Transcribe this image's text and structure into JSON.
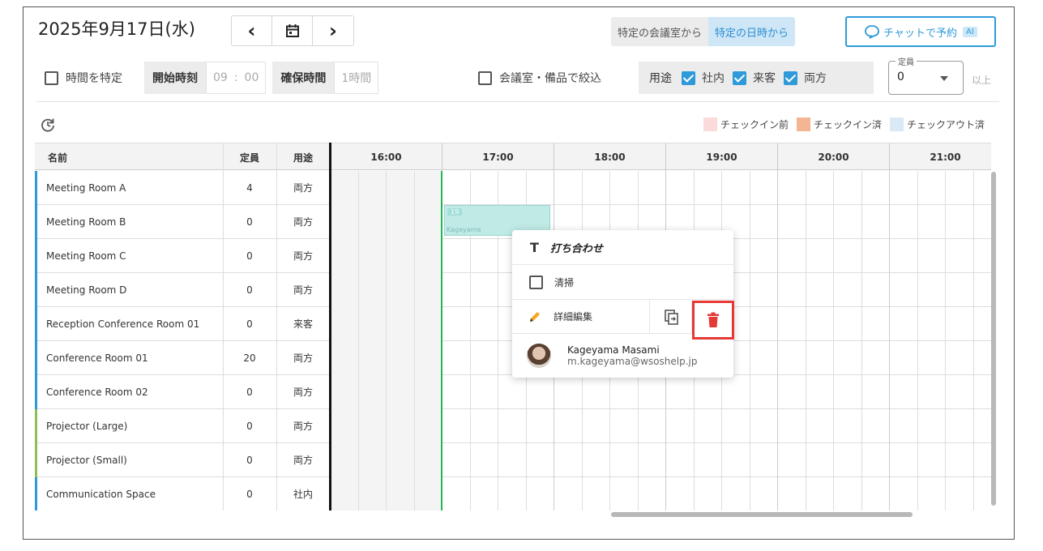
{
  "header": {
    "date_title": "2025年9月17日(水)",
    "prev_icon": "‹",
    "next_icon": "›",
    "mode_room": "特定の会議室から",
    "mode_datetime": "特定の日時から",
    "chat_button": "チャットで予約",
    "ai_badge": "AI"
  },
  "filters": {
    "time_specify_label": "時間を特定",
    "start_time_label": "開始時刻",
    "start_hour": "09",
    "time_colon": ":",
    "start_min": "00",
    "duration_label": "確保時間",
    "duration_value": "1時間",
    "room_filter_label": "会議室・備品で絞込",
    "purpose_label": "用途",
    "purpose_internal": "社内",
    "purpose_visitor": "来客",
    "purpose_both": "両方",
    "capacity_legend": "定員",
    "capacity_value": "0",
    "capacity_suffix": "以上"
  },
  "legend": {
    "before_checkin": "チェックイン前",
    "checked_in": "チェックイン済",
    "checked_out": "チェックアウト済",
    "colors": {
      "before": "#fbdada",
      "checked_in": "#f3b592",
      "checked_out": "#d9e9f6"
    }
  },
  "table": {
    "headers": {
      "name": "名前",
      "capacity": "定員",
      "purpose": "用途"
    },
    "hours": [
      "16:00",
      "17:00",
      "18:00",
      "19:00",
      "20:00",
      "21:00"
    ],
    "rooms": [
      {
        "name": "Meeting Room A",
        "capacity": "4",
        "purpose": "両方",
        "bar": "#2e9ad9"
      },
      {
        "name": "Meeting Room B",
        "capacity": "0",
        "purpose": "両方",
        "bar": "#2e9ad9"
      },
      {
        "name": "Meeting Room C",
        "capacity": "0",
        "purpose": "両方",
        "bar": "#2e9ad9"
      },
      {
        "name": "Meeting Room D",
        "capacity": "0",
        "purpose": "両方",
        "bar": "#2e9ad9"
      },
      {
        "name": "Reception Conference Room 01",
        "capacity": "0",
        "purpose": "来客",
        "bar": "#2e9ad9"
      },
      {
        "name": "Conference Room 01",
        "capacity": "20",
        "purpose": "両方",
        "bar": "#2e9ad9"
      },
      {
        "name": "Conference Room 02",
        "capacity": "0",
        "purpose": "両方",
        "bar": "#2e9ad9"
      },
      {
        "name": "Projector (Large)",
        "capacity": "0",
        "purpose": "両方",
        "bar": "#8cc152"
      },
      {
        "name": "Projector (Small)",
        "capacity": "0",
        "purpose": "両方",
        "bar": "#8cc152"
      },
      {
        "name": "Communication Space",
        "capacity": "0",
        "purpose": "社内",
        "bar": "#2e9ad9"
      }
    ]
  },
  "booking": {
    "tag": "19",
    "owner": "Kageyama"
  },
  "popup": {
    "title": "打ち合わせ",
    "cleaning": "清掃",
    "edit": "詳細編集",
    "user_name": "Kageyama Masami",
    "user_email": "m.kageyama@wsoshelp.jp"
  }
}
